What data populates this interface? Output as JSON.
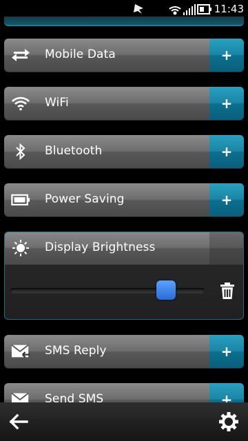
{
  "status": {
    "time": "11:43"
  },
  "tiles": [
    {
      "label": "Mobile Data",
      "action": "+",
      "icon": "mobile-data-icon"
    },
    {
      "label": "WiFi",
      "action": "+",
      "icon": "wifi-icon"
    },
    {
      "label": "Bluetooth",
      "action": "+",
      "icon": "bluetooth-icon"
    },
    {
      "label": "Power Saving",
      "action": "+",
      "icon": "battery-icon"
    },
    {
      "label": "Display Brightness",
      "icon": "brightness-icon"
    },
    {
      "label": "SMS Reply",
      "action": "+",
      "icon": "sms-reply-icon"
    },
    {
      "label": "Send SMS",
      "action": "+",
      "icon": "send-sms-icon"
    }
  ],
  "brightness": {
    "level": 0.8
  },
  "colors": {
    "accent": "#1a86a6",
    "thumb": "#3a7ef0"
  }
}
